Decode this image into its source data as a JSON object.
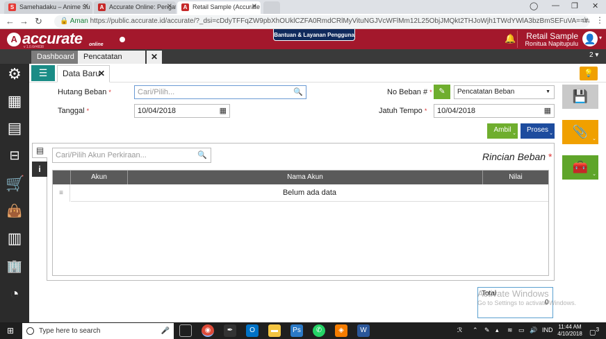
{
  "browser": {
    "tabs": [
      {
        "title": "Samehadaku – Anime Su",
        "fav_letter": "S",
        "fav_color": "#e53935"
      },
      {
        "title": "Accurate Online: Pengat",
        "fav_letter": "A",
        "fav_color": "#c62828"
      },
      {
        "title": "Retail Sample (Accurate",
        "fav_letter": "A",
        "fav_color": "#c62828"
      }
    ],
    "address": {
      "secure_label": "Aman",
      "url": "https://public.accurate.id/accurate/?_dsi=cDdyTFFqZW9pbXhOUklCZFA0RmdCRlMyVituNGJVcWFlMm12L25ObjJMQkt2THJoWjh1TWdYWlA3bzBmSEFuVA==#accurate__general..."
    }
  },
  "header": {
    "logo_text": "accurate",
    "logo_sub": "online",
    "logo_version": "v 1.0.6#4838",
    "help_label": "Bantuan & Layanan Pengguna",
    "company": "Retail Sample",
    "user": "Ronitua Napitupulu",
    "brand_color": "#a3182c"
  },
  "modules": {
    "dashboard_label": "Dashboard",
    "active_label": "Pencatatan Beban",
    "close_label": "✕",
    "count": "2"
  },
  "subtab": {
    "label": "Data Baru",
    "close": "✕"
  },
  "form": {
    "hutang_beban": {
      "label": "Hutang Beban",
      "placeholder": "Cari/Pilih..."
    },
    "tanggal": {
      "label": "Tanggal",
      "value": "10/04/2018"
    },
    "no_beban": {
      "label": "No Beban #",
      "value": "Pencatatan Beban"
    },
    "jatuh_tempo": {
      "label": "Jatuh Tempo",
      "value": "10/04/2018"
    },
    "required_mark": "*",
    "ambil_label": "Ambil",
    "proses_label": "Proses"
  },
  "detail": {
    "search_placeholder": "Cari/Pilih Akun Perkiraan...",
    "title": "Rincian Beban",
    "columns": [
      "Akun",
      "Nama Akun",
      "Nilai"
    ],
    "empty_text": "Belum ada data"
  },
  "total": {
    "label": "Total",
    "value": "0"
  },
  "watermark": {
    "line1": "Activate Windows",
    "line2": "Go to Settings to activate Windows."
  },
  "taskbar": {
    "search_placeholder": "Type here to search",
    "lang": "IND",
    "time": "11:44 AM",
    "date": "4/10/2018",
    "notif_count": "3"
  }
}
